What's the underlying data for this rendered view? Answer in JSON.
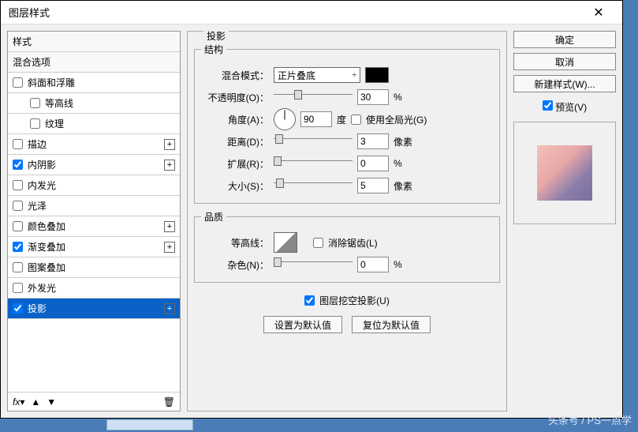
{
  "titlebar": {
    "title": "图层样式",
    "close": "✕"
  },
  "stylelist": {
    "header1": "样式",
    "header2": "混合选项",
    "items": [
      {
        "label": "斜面和浮雕",
        "checked": false,
        "plus": false,
        "indent": false
      },
      {
        "label": "等高线",
        "checked": false,
        "plus": false,
        "indent": true
      },
      {
        "label": "纹理",
        "checked": false,
        "plus": false,
        "indent": true
      },
      {
        "label": "描边",
        "checked": false,
        "plus": true,
        "indent": false
      },
      {
        "label": "内阴影",
        "checked": true,
        "plus": true,
        "indent": false
      },
      {
        "label": "内发光",
        "checked": false,
        "plus": false,
        "indent": false
      },
      {
        "label": "光泽",
        "checked": false,
        "plus": false,
        "indent": false
      },
      {
        "label": "颜色叠加",
        "checked": false,
        "plus": true,
        "indent": false
      },
      {
        "label": "渐变叠加",
        "checked": true,
        "plus": true,
        "indent": false
      },
      {
        "label": "图案叠加",
        "checked": false,
        "plus": false,
        "indent": false
      },
      {
        "label": "外发光",
        "checked": false,
        "plus": false,
        "indent": false
      },
      {
        "label": "投影",
        "checked": true,
        "plus": true,
        "indent": false,
        "selected": true
      }
    ],
    "footer": {
      "fx": "fx",
      "up": "▲",
      "down": "▼",
      "trash": "🗑"
    }
  },
  "panel": {
    "title": "投影",
    "structure": {
      "legend": "结构",
      "blend_label": "混合模式：",
      "blend_value": "正片叠底",
      "opacity_label": "不透明度(O)：",
      "opacity_value": "30",
      "opacity_unit": "%",
      "angle_label": "角度(A)：",
      "angle_value": "90",
      "angle_unit": "度",
      "global_light": "使用全局光(G)",
      "distance_label": "距离(D)：",
      "distance_value": "3",
      "distance_unit": "像素",
      "spread_label": "扩展(R)：",
      "spread_value": "0",
      "spread_unit": "%",
      "size_label": "大小(S)：",
      "size_value": "5",
      "size_unit": "像素"
    },
    "quality": {
      "legend": "品质",
      "contour_label": "等高线：",
      "antialias": "消除锯齿(L)",
      "noise_label": "杂色(N)：",
      "noise_value": "0",
      "noise_unit": "%"
    },
    "knockout": "图层挖空投影(U)",
    "make_default": "设置为默认值",
    "reset_default": "复位为默认值"
  },
  "right": {
    "ok": "确定",
    "cancel": "取消",
    "new_style": "新建样式(W)...",
    "preview": "预览(V)"
  },
  "watermark": "头条号 / PS一点学"
}
